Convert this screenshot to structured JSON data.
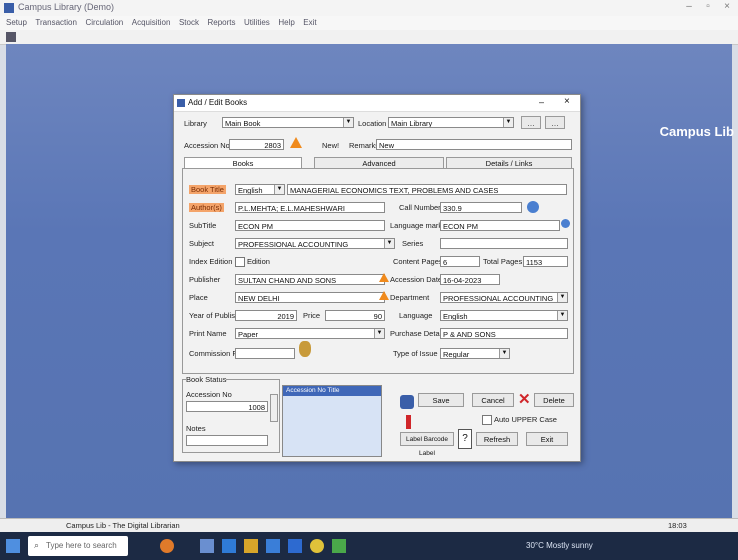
{
  "app": {
    "title": "Campus Library (Demo)",
    "menu": [
      "Setup",
      "Transaction",
      "Circulation",
      "Acquisition",
      "Stock",
      "Reports",
      "Utilities",
      "Help",
      "Exit"
    ],
    "brand_name": "Campus Lib",
    "brand_sub": "",
    "brand_desc": ""
  },
  "dialog": {
    "title": "Add / Edit Books",
    "library_label": "Library",
    "library_value": "Main Book",
    "location_label": "Location",
    "location_value": "Main Library",
    "accession_label": "Accession No",
    "accession_value": "2803",
    "new_label": "New!",
    "remarks_label": "Remarks",
    "remarks_value": "New",
    "tabs": [
      "Books",
      "Advanced",
      "Details / Links"
    ],
    "fields": {
      "book_title_label": "Book Title",
      "book_title_type": "English",
      "book_title_value": "MANAGERIAL ECONOMICS TEXT, PROBLEMS AND CASES",
      "authors_label": "Author(s)",
      "authors_value": "P.L.MEHTA; E.L.MAHESHWARI",
      "call_number_label": "Call Number",
      "call_number_value": "330.9",
      "subtitle_label": "SubTitle",
      "subtitle_value": "ECON PM",
      "lang_mark_label": "Language mark",
      "lang_mark_value": "ECON PM",
      "subject_label": "Subject",
      "subject_value": "PROFESSIONAL ACCOUNTING",
      "series_label": "Series",
      "index_edition_label": "Index Edition",
      "edition_label": "Edition",
      "content_pages_label": "Content Pages",
      "content_pages_value": "6",
      "total_pages_label": "Total Pages",
      "total_pages_value": "1153",
      "publisher_label": "Publisher",
      "publisher_value": "SULTAN CHAND AND SONS",
      "accession_date_label": "Accession Date",
      "accession_date_value": "16-04-2023",
      "place_label": "Place",
      "place_value": "NEW DELHI",
      "department_label": "Department",
      "department_value": "PROFESSIONAL ACCOUNTING",
      "year_label": "Year of Publishing",
      "year_value": "2019",
      "price_label": "Price",
      "price_value": "90",
      "language_label": "Language",
      "language_value": "English",
      "print_name_label": "Print Name",
      "print_name_value": "Paper",
      "purchased_label": "Purchase Details",
      "purchased_value": "P & AND SONS",
      "cover_label": "Commission Fold",
      "type_label": "Type of Issue",
      "type_value": "Regular"
    },
    "book_status": {
      "group_label": "Book Status",
      "accession_label": "Accession No",
      "accession_value": "1008",
      "notes_label": "Notes",
      "list_header": "Accession No  Title"
    },
    "buttons": {
      "save": "Save",
      "cancel": "Cancel",
      "delete": "Delete",
      "auto_upper": "Auto UPPER Case",
      "refresh": "Refresh",
      "exit": "Exit",
      "label_print": "Label Barcode Label"
    }
  },
  "status": {
    "left": "Campus Lib - The Digital Librarian",
    "right": "18:03"
  },
  "taskbar": {
    "search_placeholder": "Type here to search",
    "tray_text": "30°C Mostly sunny"
  }
}
